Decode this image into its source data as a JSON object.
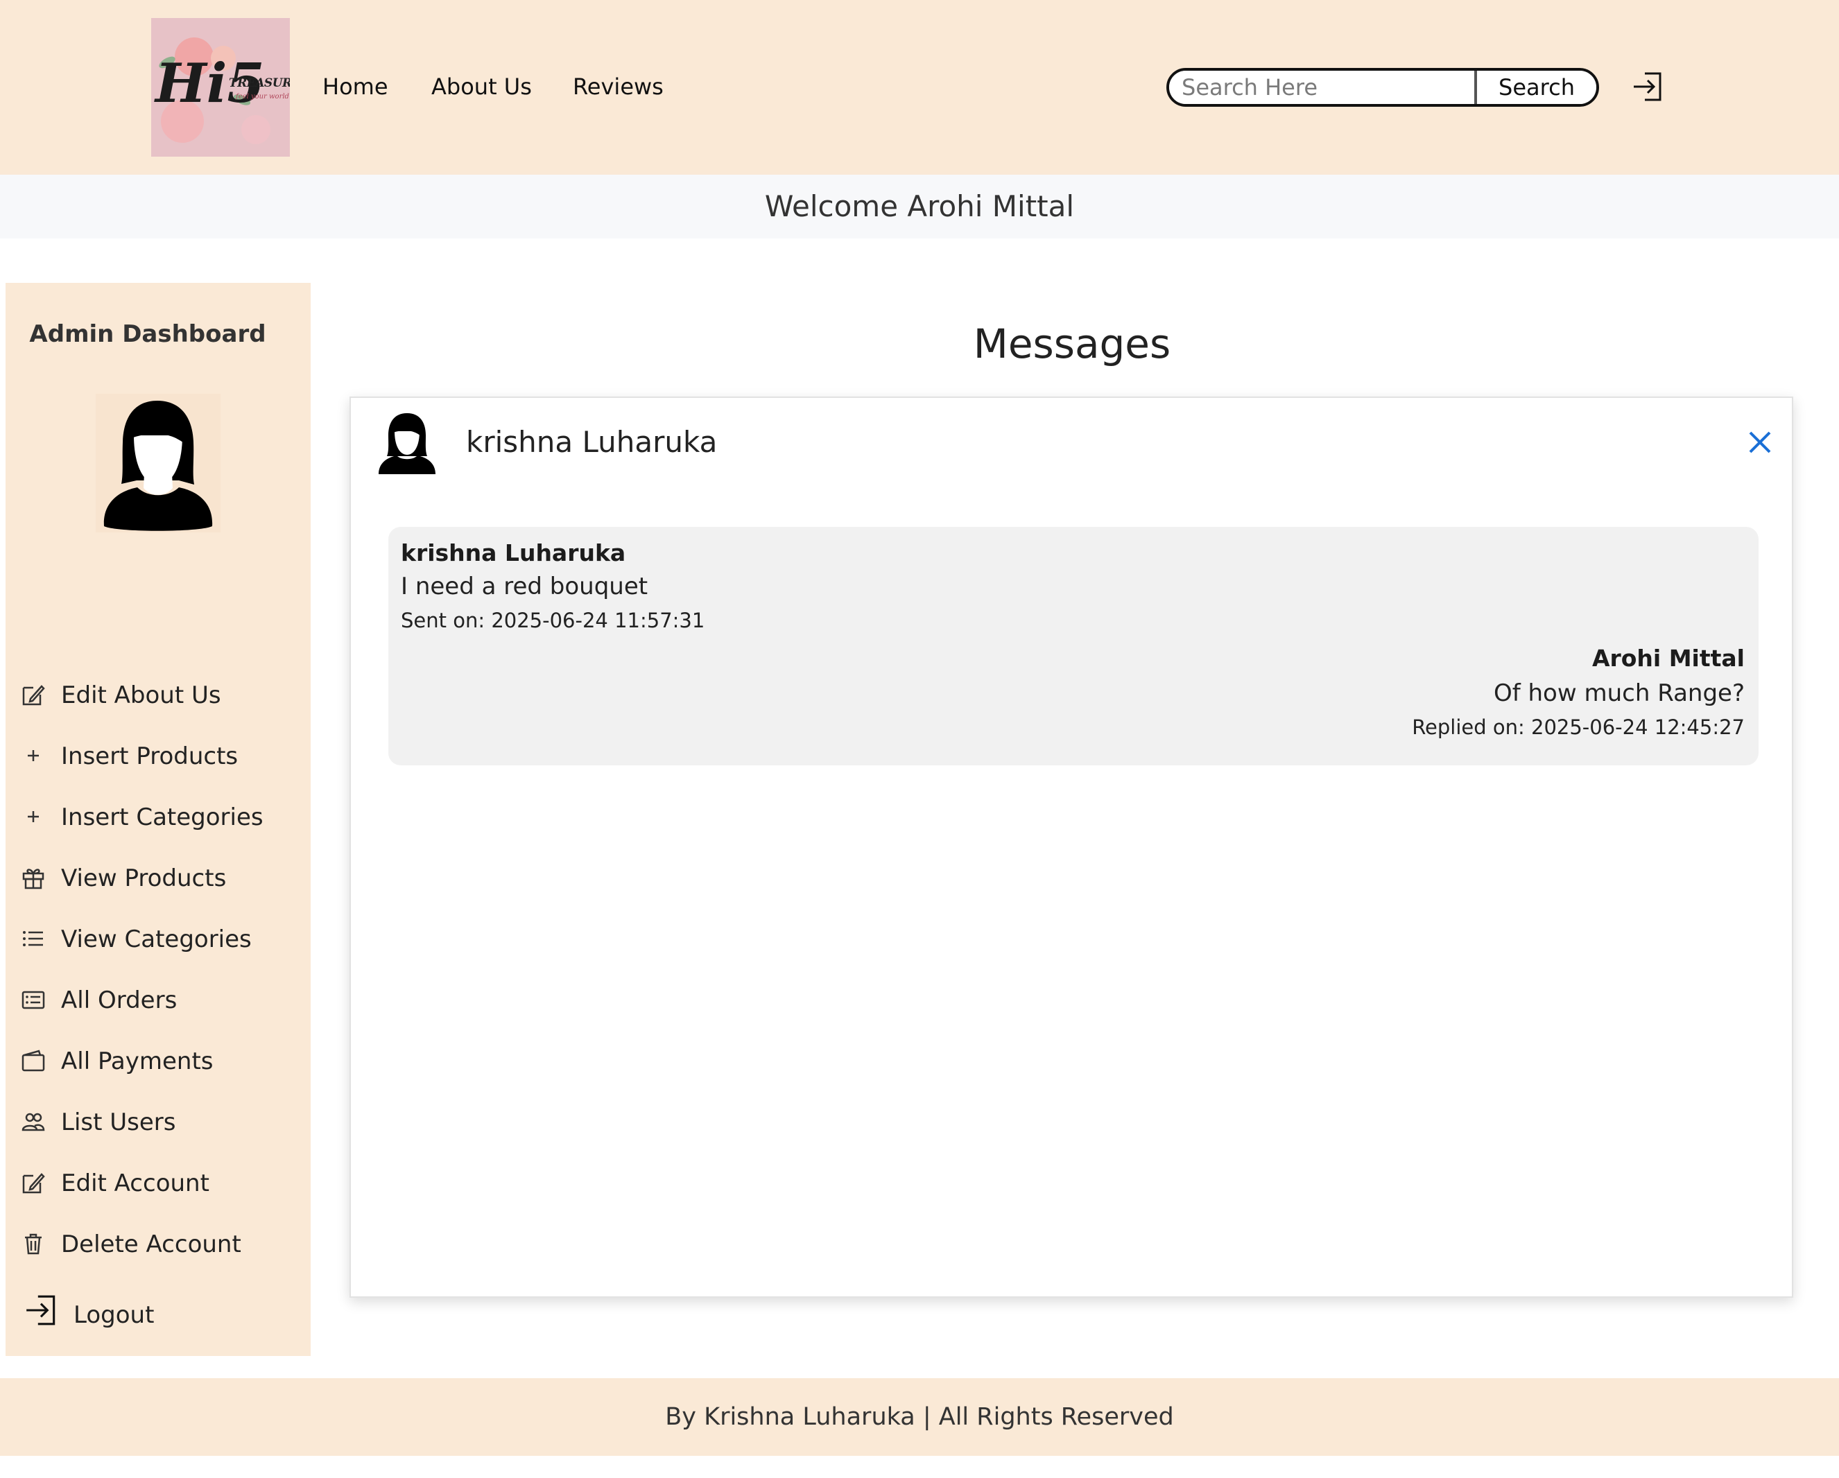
{
  "header": {
    "logo": {
      "main": "Hi5",
      "sub": "TREASURES",
      "tagline": "feel your world"
    },
    "nav": [
      "Home",
      "About Us",
      "Reviews"
    ],
    "search": {
      "placeholder": "Search Here",
      "button_label": "Search"
    },
    "login_icon": "box-arrow-in-right-icon"
  },
  "welcome": "Welcome Arohi Mittal",
  "sidebar": {
    "title": "Admin Dashboard",
    "avatar_icon": "female-user-icon",
    "items": [
      {
        "label": "Edit About Us",
        "icon": "pencil-square-icon"
      },
      {
        "label": "Insert Products",
        "icon": "plus-icon"
      },
      {
        "label": "Insert Categories",
        "icon": "plus-icon"
      },
      {
        "label": "View Products",
        "icon": "gift-icon"
      },
      {
        "label": "View Categories",
        "icon": "list-icon"
      },
      {
        "label": "All Orders",
        "icon": "card-list-icon"
      },
      {
        "label": "All Payments",
        "icon": "wallet-icon"
      },
      {
        "label": "List Users",
        "icon": "people-icon"
      },
      {
        "label": "Edit Account",
        "icon": "pencil-square-icon"
      },
      {
        "label": "Delete Account",
        "icon": "trash-icon"
      }
    ],
    "logout": {
      "label": "Logout",
      "icon": "box-arrow-in-right-icon"
    }
  },
  "main": {
    "title": "Messages",
    "chat": {
      "contact_name": "krishna Luharuka",
      "close_icon": "close-icon",
      "message": {
        "from": "krishna Luharuka",
        "text": "I need a red bouquet",
        "time": "Sent on: 2025-06-24 11:57:31"
      },
      "reply": {
        "from": "Arohi Mittal",
        "text": "Of how much Range?",
        "time": "Replied on: 2025-06-24 12:45:27"
      }
    }
  },
  "footer": "By Krishna Luharuka | All Rights Reserved",
  "colors": {
    "header_bg": "#fae9d6",
    "welcome_bg": "#f7f8fa",
    "thread_bg": "#f1f1f1",
    "close_blue": "#1a6fd6"
  }
}
